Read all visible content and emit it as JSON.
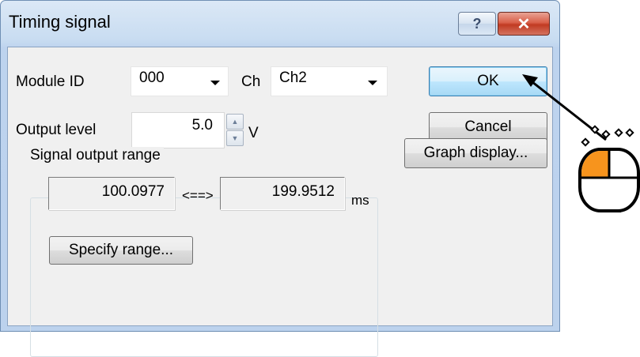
{
  "window": {
    "title": "Timing signal",
    "help_label": "?",
    "close_label": "✕"
  },
  "module": {
    "label": "Module ID",
    "value": "000"
  },
  "channel": {
    "label": "Ch",
    "value": "Ch2"
  },
  "output": {
    "label": "Output level",
    "value": "5.0",
    "unit": "V"
  },
  "range": {
    "group_label": "Signal output range",
    "start": "100.0977",
    "separator": "<==>",
    "end": "199.9512",
    "unit": "ms",
    "specify_button": "Specify range..."
  },
  "buttons": {
    "ok": "OK",
    "cancel": "Cancel",
    "graph": "Graph display..."
  },
  "colors": {
    "mouse_accent": "#f7941d"
  }
}
